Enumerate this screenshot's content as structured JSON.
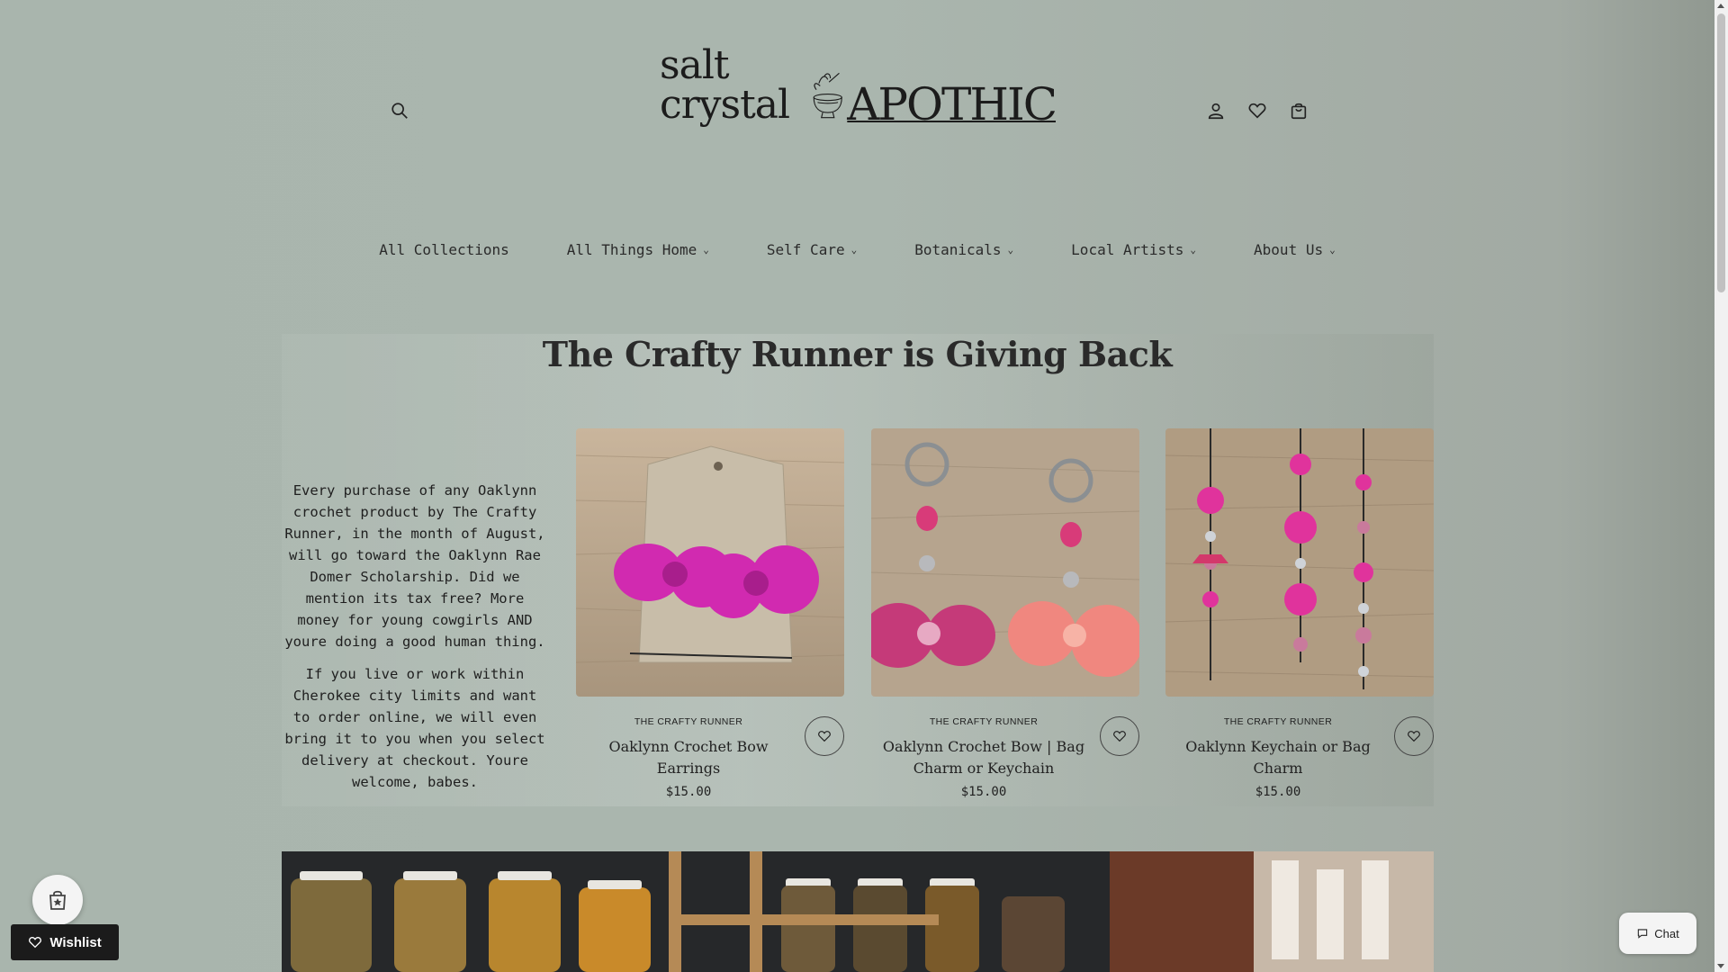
{
  "header": {
    "logo_text_left": "salt crystal",
    "logo_text_right": "APOTHIC",
    "icons": [
      "search-icon",
      "account-icon",
      "heart-icon",
      "bag-icon"
    ]
  },
  "nav": {
    "items": [
      {
        "label": "All Collections",
        "has_dropdown": false
      },
      {
        "label": "All Things Home",
        "has_dropdown": true
      },
      {
        "label": "Self Care",
        "has_dropdown": true
      },
      {
        "label": "Botanicals",
        "has_dropdown": true
      },
      {
        "label": "Local Artists",
        "has_dropdown": true
      },
      {
        "label": "About Us",
        "has_dropdown": true
      }
    ]
  },
  "feature": {
    "title": "The Crafty Runner is Giving Back",
    "paragraph1": "Every purchase of any Oaklynn crochet product by The Crafty Runner, in the month of August, will go toward the Oaklynn Rae Domer Scholarship. Did we mention its tax free? More money for young cowgirls AND youre doing a good human thing.",
    "paragraph2": "If you live or work within Cherokee city limits and want to order online, we will even bring it to you when you select delivery at checkout. Youre welcome, babes."
  },
  "products": [
    {
      "vendor": "THE CRAFTY RUNNER",
      "name": "Oaklynn Crochet Bow Earrings",
      "price": "$15.00"
    },
    {
      "vendor": "THE CRAFTY RUNNER",
      "name": "Oaklynn Crochet Bow | Bag Charm or Keychain",
      "price": "$15.00"
    },
    {
      "vendor": "THE CRAFTY RUNNER",
      "name": "Oaklynn Keychain or Bag Charm",
      "price": "$15.00"
    }
  ],
  "floating": {
    "wishlist_label": "Wishlist",
    "chat_label": "Chat"
  },
  "colors": {
    "background": "#a9b5ad",
    "text": "#1f1f1f",
    "button_dark": "#1b1b1b",
    "product_pink": "#d92a9e"
  }
}
